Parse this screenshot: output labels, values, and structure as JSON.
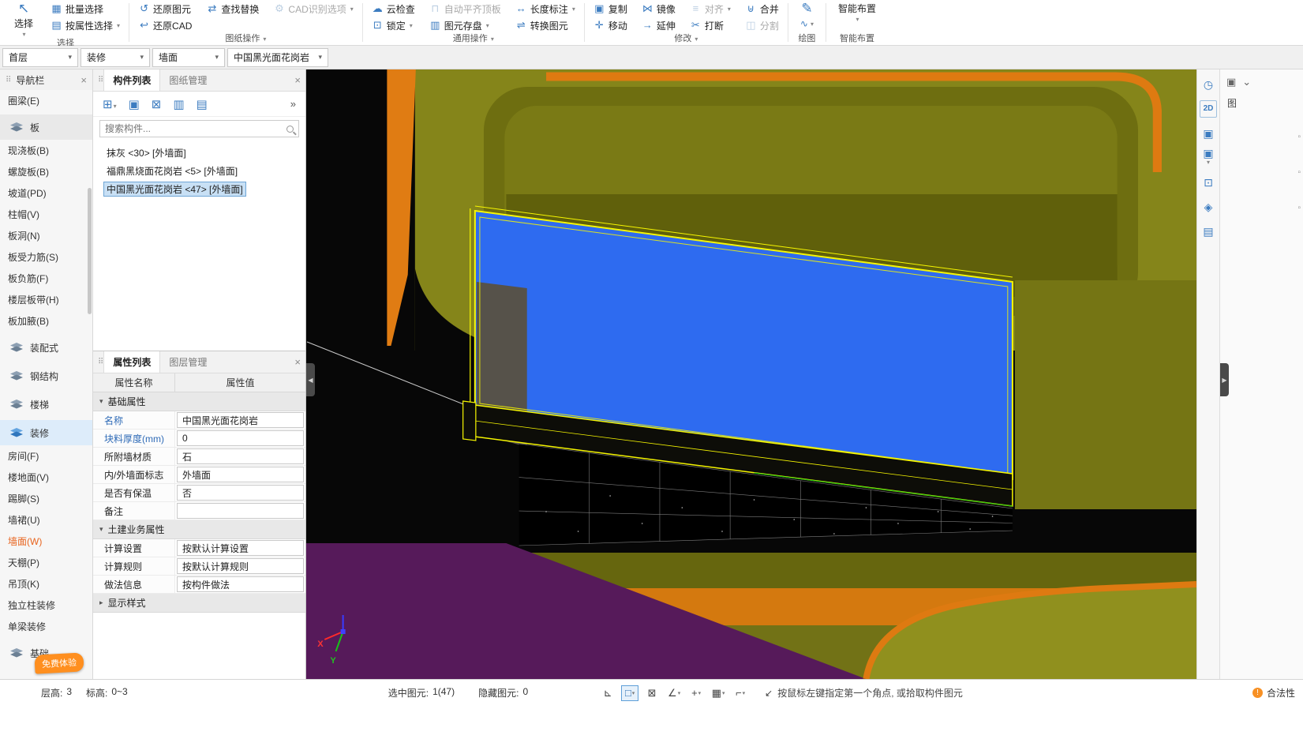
{
  "ribbon": {
    "groups": {
      "select": {
        "label": "选择"
      },
      "drawing_ops": {
        "label": "图纸操作"
      },
      "general_ops": {
        "label": "通用操作"
      },
      "modify": {
        "label": "修改"
      },
      "draw": {
        "label": "绘图"
      },
      "smart": {
        "label": "智能布置"
      }
    },
    "buttons": {
      "select": "选择",
      "batch_select": "批量选择",
      "select_by_property": "按属性选择",
      "restore_element": "还原图元",
      "find_replace": "查找替换",
      "cad_recognize_options": "CAD识别选项",
      "restore_cad": "还原CAD",
      "cloud_check": "云检查",
      "auto_align_top_slab": "自动平齐顶板",
      "length_annotation": "长度标注",
      "lock": "锁定",
      "element_save": "图元存盘",
      "convert_element": "转换图元",
      "copy": "复制",
      "mirror": "镜像",
      "align": "对齐",
      "merge": "合并",
      "move": "移动",
      "extend": "延伸",
      "break": "打断",
      "split": "分割",
      "smart_layout": "智能布置"
    }
  },
  "context": {
    "floor": "首层",
    "category": "装修",
    "element": "墙面",
    "component": "中国黑光面花岗岩"
  },
  "nav": {
    "title": "导航栏",
    "items": [
      {
        "label": "圈梁(E)"
      },
      {
        "label": "板"
      },
      {
        "label": "现浇板(B)"
      },
      {
        "label": "螺旋板(B)"
      },
      {
        "label": "坡道(PD)"
      },
      {
        "label": "柱帽(V)"
      },
      {
        "label": "板洞(N)"
      },
      {
        "label": "板受力筋(S)"
      },
      {
        "label": "板负筋(F)"
      },
      {
        "label": "楼层板带(H)"
      },
      {
        "label": "板加腋(B)"
      },
      {
        "label": "装配式"
      },
      {
        "label": "钢结构"
      },
      {
        "label": "楼梯"
      },
      {
        "label": "装修"
      },
      {
        "label": "房间(F)"
      },
      {
        "label": "楼地面(V)"
      },
      {
        "label": "踢脚(S)"
      },
      {
        "label": "墙裙(U)"
      },
      {
        "label": "墙面(W)"
      },
      {
        "label": "天棚(P)"
      },
      {
        "label": "吊顶(K)"
      },
      {
        "label": "独立柱装修"
      },
      {
        "label": "单梁装修"
      },
      {
        "label": "基础"
      }
    ],
    "promo_badge": "免费体验"
  },
  "components": {
    "tabs": {
      "list": "构件列表",
      "drawings": "图纸管理"
    },
    "search_placeholder": "搜索构件...",
    "items": [
      {
        "label": "抹灰 <30> [外墙面]"
      },
      {
        "label": "福鼎黑烧面花岗岩 <5> [外墙面]"
      },
      {
        "label": "中国黑光面花岗岩 <47> [外墙面]"
      }
    ]
  },
  "properties": {
    "tabs": {
      "props": "属性列表",
      "layers": "图层管理"
    },
    "columns": {
      "name": "属性名称",
      "value": "属性值"
    },
    "sections": {
      "basic": "基础属性",
      "civil": "土建业务属性",
      "display": "显示样式"
    },
    "basic_rows": [
      {
        "name": "名称",
        "value": "中国黑光面花岗岩"
      },
      {
        "name": "块料厚度(mm)",
        "value": "0"
      },
      {
        "name": "所附墙材质",
        "value": "石"
      },
      {
        "name": "内/外墙面标志",
        "value": "外墙面"
      },
      {
        "name": "是否有保温",
        "value": "否"
      },
      {
        "name": "备注",
        "value": ""
      }
    ],
    "civil_rows": [
      {
        "name": "计算设置",
        "value": "按默认计算设置"
      },
      {
        "name": "计算规则",
        "value": "按默认计算规则"
      },
      {
        "name": "做法信息",
        "value": "按构件做法"
      }
    ]
  },
  "viewport": {
    "axis_x": "X",
    "axis_y": "Y",
    "rail_2d": "2D"
  },
  "right_strip": {
    "partial_label": "图"
  },
  "statusbar": {
    "floor_height_label": "层高:",
    "floor_height_value": "3",
    "elevation_label": "标高:",
    "elevation_value": "0~3",
    "selected_label": "选中图元:",
    "selected_value": "1(47)",
    "hidden_label": "隐藏图元:",
    "hidden_value": "0",
    "hint": "按鼠标左键指定第一个角点, 或拾取构件图元",
    "legality": "合法性"
  },
  "colors": {
    "selection_blue": "#2e6bf0",
    "highlight_yellow": "#f6f600",
    "wall_olive": "#85851a",
    "wall_orange": "#df7b12",
    "floor_purple": "#561a5a",
    "active_text_orange": "#e8641e"
  }
}
